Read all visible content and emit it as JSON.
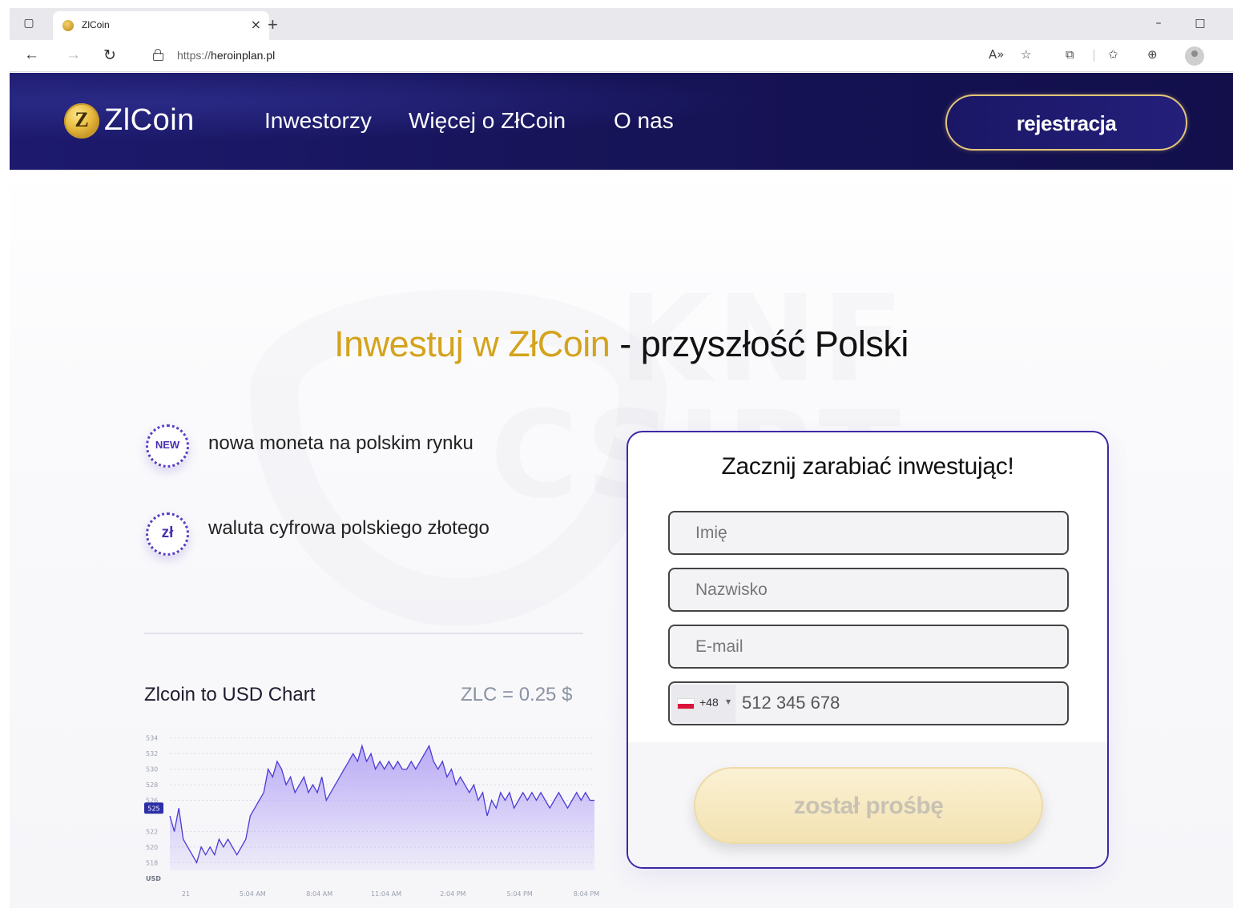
{
  "browser": {
    "tab_title": "ZlCoin",
    "url_protocol": "https://",
    "url_host": "heroinplan.pl",
    "icons": [
      "sidebar-toggle-icon",
      "favicon-coin",
      "close-tab-icon",
      "new-tab-icon",
      "back-icon",
      "forward-icon",
      "refresh-icon",
      "lock-icon",
      "read-aloud-icon",
      "add-favorite-icon",
      "extensions-icon",
      "favorites-icon",
      "collections-icon",
      "profile-icon",
      "minimize-icon",
      "maximize-icon"
    ]
  },
  "header": {
    "logo_letter": "Z",
    "logo_text": "ZlCoin",
    "nav": [
      "Inwestorzy",
      "Więcej o ZłCoin",
      "O nas"
    ],
    "register_label": "rejestracja",
    "colors": {
      "background": "#171459",
      "accent_gold": "#e3c57a"
    }
  },
  "hero": {
    "title_gold": "Inwestuj w ZłCoin",
    "title_rest": " - przyszłość Polski",
    "gold_color": "#d4a31d"
  },
  "features": [
    {
      "icon": "new-badge-icon",
      "icon_text": "NEW",
      "text": "nowa moneta na polskim rynku"
    },
    {
      "icon": "zloty-coin-icon",
      "icon_text": "zł",
      "text": "waluta cyfrowa polskiego złotego"
    }
  ],
  "watermark": [
    "KNF",
    "CSIRT"
  ],
  "chart_section": {
    "title": "Zlcoin to USD Chart",
    "price": "ZLC = 0.25 $"
  },
  "chart_data": {
    "type": "area",
    "ylabel": "USD",
    "ylim": [
      517,
      535
    ],
    "y_ticks": [
      534,
      532,
      530,
      528,
      526,
      522,
      520,
      518
    ],
    "x_ticks": [
      "21",
      "5:04 AM",
      "8:04 AM",
      "11:04 AM",
      "2:04 PM",
      "5:04 PM",
      "8:04 PM"
    ],
    "current_marker": 525,
    "grid": true,
    "line_color": "#4b3bd6",
    "fill_color": "#b7a7f5",
    "series": [
      {
        "values": [
          524,
          522,
          525,
          521,
          520,
          519,
          518,
          520,
          519,
          520,
          519,
          521,
          520,
          521,
          520,
          519,
          520,
          521,
          524,
          525,
          526,
          527,
          530,
          529,
          531,
          530,
          528,
          529,
          527,
          528,
          529,
          527,
          528,
          527,
          529,
          526,
          527,
          528,
          529,
          530,
          531,
          532,
          531,
          533,
          531,
          532,
          530,
          531,
          530,
          531,
          530,
          531,
          530,
          530,
          531,
          530,
          531,
          532,
          533,
          531,
          530,
          531,
          529,
          530,
          528,
          529,
          528,
          527,
          528,
          526,
          527,
          524,
          526,
          525,
          527,
          526,
          527,
          525,
          526,
          527,
          526,
          527,
          526,
          527,
          526,
          525,
          526,
          527,
          526,
          525,
          526,
          527,
          526,
          527,
          526,
          526
        ]
      }
    ]
  },
  "form": {
    "title": "Zacznij zarabiać inwestując!",
    "first_name_placeholder": "Imię",
    "last_name_placeholder": "Nazwisko",
    "email_placeholder": "E-mail",
    "phone_dial_code": "+48",
    "phone_value": "512 345 678",
    "submit_label": "został prośbę",
    "colors": {
      "border": "#3b2aa8",
      "submit": "#f3e2b1"
    }
  }
}
